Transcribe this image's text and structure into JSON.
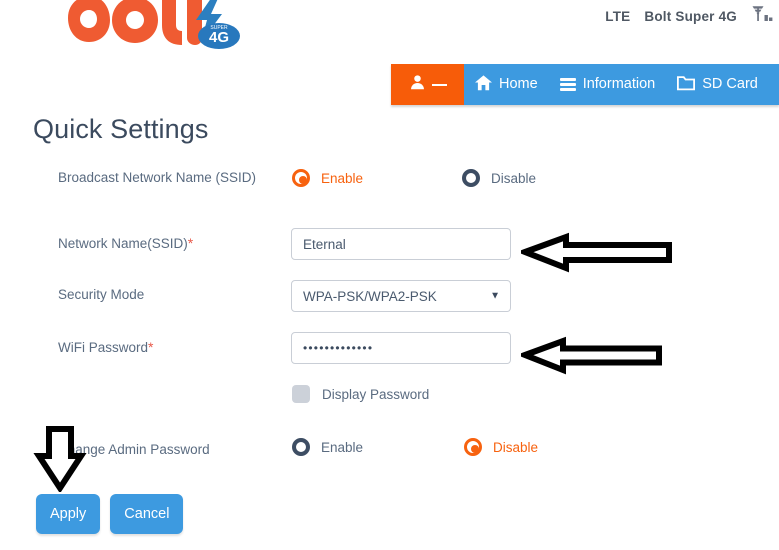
{
  "header": {
    "logo_text": "BOLT",
    "logo_badge": "4G",
    "status_network_type": "LTE",
    "status_operator": "Bolt Super 4G",
    "signal_icon": "signal-antenna-icon"
  },
  "nav": {
    "user_tab": {
      "icon": "user-icon",
      "label": ""
    },
    "items": [
      {
        "label": "Home",
        "icon": "home-icon"
      },
      {
        "label": "Information",
        "icon": "list-icon"
      },
      {
        "label": "SD Card",
        "icon": "folder-icon"
      }
    ]
  },
  "page": {
    "title": "Quick Settings"
  },
  "form": {
    "broadcast": {
      "label": "Broadcast Network Name (SSID)",
      "enable_label": "Enable",
      "disable_label": "Disable",
      "selected": "Enable"
    },
    "ssid": {
      "label": "Network Name(SSID)",
      "required_marker": "*",
      "value": "Eternal",
      "placeholder": ""
    },
    "security_mode": {
      "label": "Security Mode",
      "value": "WPA-PSK/WPA2-PSK",
      "caret": "▼",
      "options": [
        "WPA-PSK/WPA2-PSK"
      ]
    },
    "wifi_password": {
      "label": "WiFi Password",
      "required_marker": "*",
      "value": "•••••••••••••",
      "placeholder": ""
    },
    "display_password": {
      "label": "Display Password",
      "checked": false
    },
    "admin_password": {
      "label": "Change Admin Password",
      "enable_label": "Enable",
      "disable_label": "Disable",
      "selected": "Disable"
    }
  },
  "buttons": {
    "apply_label": "Apply",
    "cancel_label": "Cancel"
  },
  "annotations": {
    "arrow_ssid": "left-arrow-annotation",
    "arrow_password": "left-arrow-annotation",
    "arrow_admin": "down-arrow-annotation"
  },
  "colors": {
    "brand_orange": "#f7620f",
    "brand_blue": "#3d9ae0",
    "nav_blue": "#3d9ae0",
    "label_gray": "#5a6b80",
    "title_navy": "#3b4a5e",
    "required_red": "#e8594a"
  }
}
